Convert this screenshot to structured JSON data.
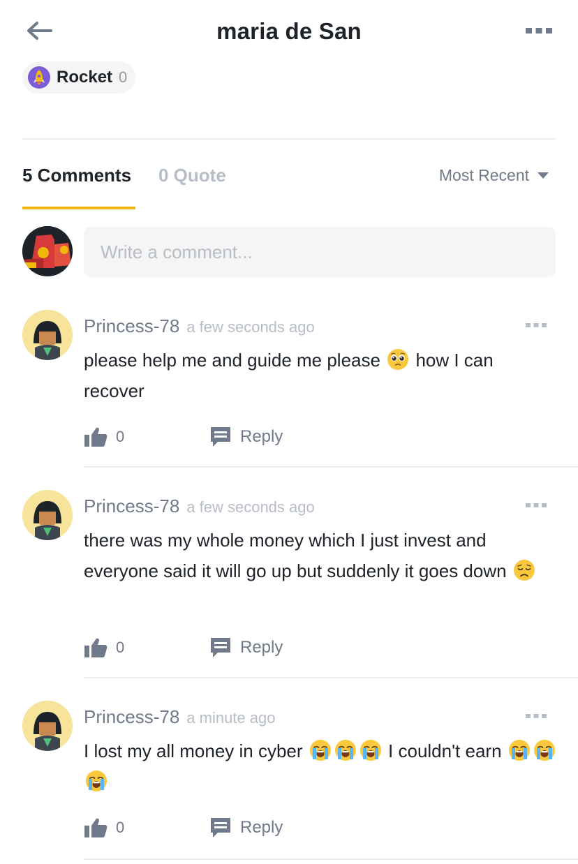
{
  "header": {
    "title": "maria de San",
    "back_icon": "arrow-left-icon",
    "more_icon": "more-horizontal-icon"
  },
  "reaction": {
    "icon": "rocket-icon",
    "label": "Rocket",
    "count": "0"
  },
  "tabs": {
    "comments_label": "5 Comments",
    "quote_label": "0 Quote",
    "sort_label": "Most Recent"
  },
  "composer": {
    "placeholder": "Write a comment..."
  },
  "comments": [
    {
      "user": "Princess-78",
      "time": "a few seconds ago",
      "text_parts": [
        "please help me and guide me please",
        "how I can recover"
      ],
      "emojis": [
        "pleading-face"
      ],
      "likes": "0",
      "reply_label": "Reply"
    },
    {
      "user": "Princess-78",
      "time": "a few seconds ago",
      "text_parts": [
        "there was my whole money which I just invest and everyone said it will go up but suddenly it goes down"
      ],
      "emojis": [
        "disappointed-face"
      ],
      "likes": "0",
      "reply_label": "Reply"
    },
    {
      "user": "Princess-78",
      "time": "a minute ago",
      "text_parts": [
        "I lost my all money in cyber",
        "I couldn't earn"
      ],
      "emojis": [
        "loudly-crying-face",
        "loudly-crying-face",
        "loudly-crying-face",
        "loudly-crying-face",
        "loudly-crying-face",
        "loudly-crying-face"
      ],
      "likes": "0",
      "reply_label": "Reply"
    }
  ],
  "colors": {
    "accent": "#f0b90b",
    "text_primary": "#1e2329",
    "text_secondary": "#707a8a",
    "text_muted": "#b7bdc6",
    "input_bg": "#f5f5f5",
    "divider": "#eaecef"
  }
}
